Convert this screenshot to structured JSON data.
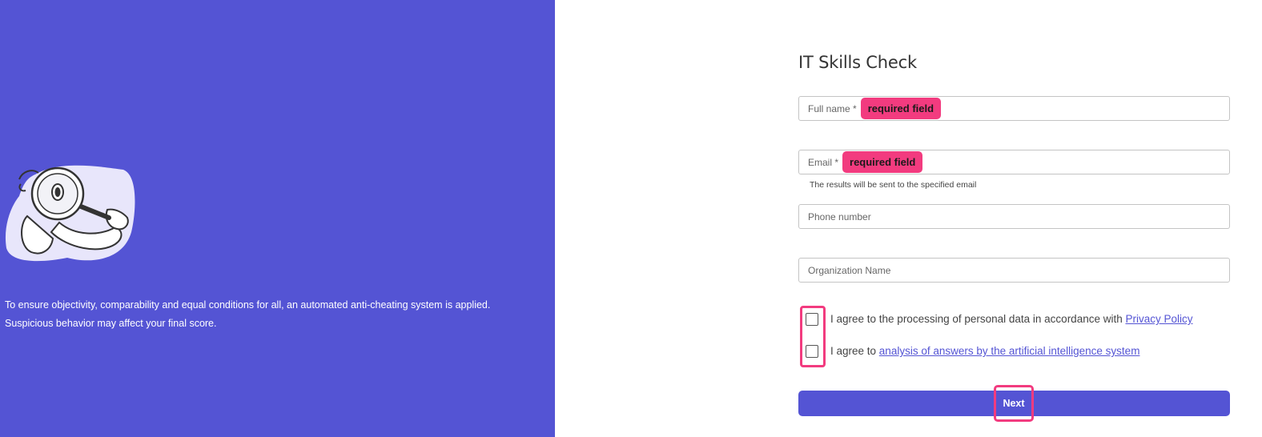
{
  "left": {
    "notice_line1": "To ensure objectivity, comparability and equal conditions for all, an automated anti-cheating system is applied.",
    "notice_line2": "Suspicious behavior may affect your final score."
  },
  "form": {
    "title": "IT Skills Check",
    "full_name_placeholder": "Full name *",
    "full_name_error": "required field",
    "email_placeholder": "Email *",
    "email_error": "required field",
    "email_hint": "The results will be sent to the specified email",
    "phone_placeholder": "Phone number",
    "org_placeholder": "Organization Name",
    "consent1_text": "I agree to the processing of personal data in accordance with ",
    "consent1_link": "Privacy Policy",
    "consent2_text": "I agree to ",
    "consent2_link": "analysis of answers by the artificial intelligence system",
    "next_label": "Next"
  },
  "colors": {
    "brand": "#5454d4",
    "error_highlight": "#f23b7f"
  }
}
